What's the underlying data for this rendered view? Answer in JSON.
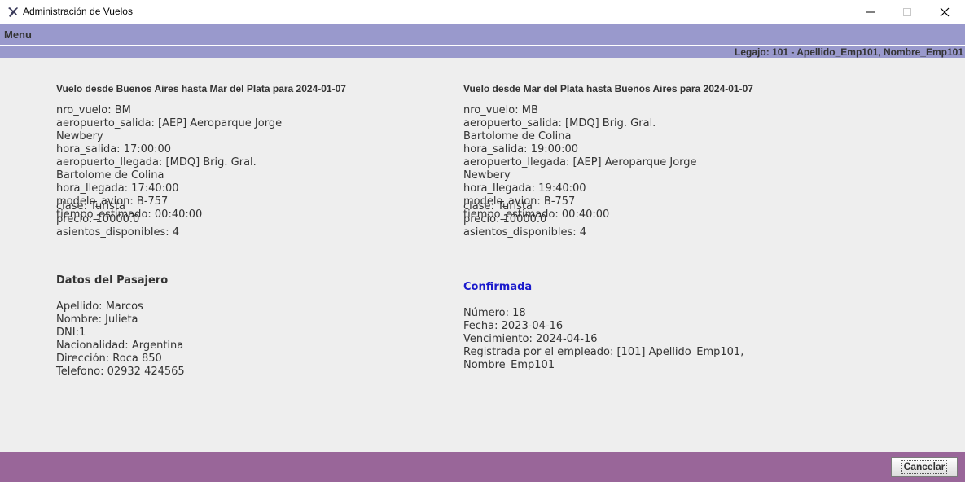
{
  "window": {
    "title": "Administración de Vuelos",
    "icon": "airplane-icon"
  },
  "menu": {
    "label": "Menu"
  },
  "status": {
    "text": "Legajo: 101 - Apellido_Emp101, Nombre_Emp101"
  },
  "flight_outbound": {
    "title": "Vuelo desde Buenos Aires hasta Mar del Plata para 2024-01-07",
    "lines": [
      "nro_vuelo: BM",
      "aeropuerto_salida: [AEP] Aeroparque Jorge",
      "Newbery",
      "hora_salida: 17:00:00",
      "aeropuerto_llegada: [MDQ] Brig. Gral.",
      "Bartolome de Colina",
      "hora_llegada: 17:40:00",
      "modelo_avion: B-757",
      "tiempo_estimado: 00:40:00",
      "asientos_disponibles: 4"
    ],
    "overlap_lines": [
      "clase: Turista",
      "precio: 10000.0"
    ]
  },
  "flight_return": {
    "title": "Vuelo desde Mar del Plata hasta Buenos Aires para 2024-01-07",
    "lines": [
      "nro_vuelo: MB",
      "aeropuerto_salida: [MDQ] Brig. Gral.",
      "Bartolome de Colina",
      "hora_salida: 19:00:00",
      "aeropuerto_llegada: [AEP] Aeroparque Jorge",
      "Newbery",
      "hora_llegada: 19:40:00",
      "modelo_avion: B-757",
      "tiempo_estimado: 00:40:00",
      "asientos_disponibles: 4"
    ],
    "overlap_lines": [
      "clase: Turista",
      "precio: 10000.0"
    ]
  },
  "passenger": {
    "title": "Datos del Pasajero",
    "lines": [
      "Apellido: Marcos",
      "Nombre: Julieta",
      "DNI:1",
      "Nacionalidad: Argentina",
      "Dirección: Roca 850",
      "Telefono: 02932 424565"
    ]
  },
  "reservation": {
    "status": "Confirmada",
    "status_color": "#1a1acc",
    "lines": [
      "Número: 18",
      "Fecha: 2023-04-16",
      "Vencimiento: 2024-04-16",
      "Registrada por el empleado: [101] Apellido_Emp101,",
      "Nombre_Emp101"
    ]
  },
  "footer": {
    "cancel_label": "Cancelar"
  },
  "colors": {
    "menubar": "#9999cc",
    "footer": "#996699",
    "background": "#eeeeee"
  }
}
